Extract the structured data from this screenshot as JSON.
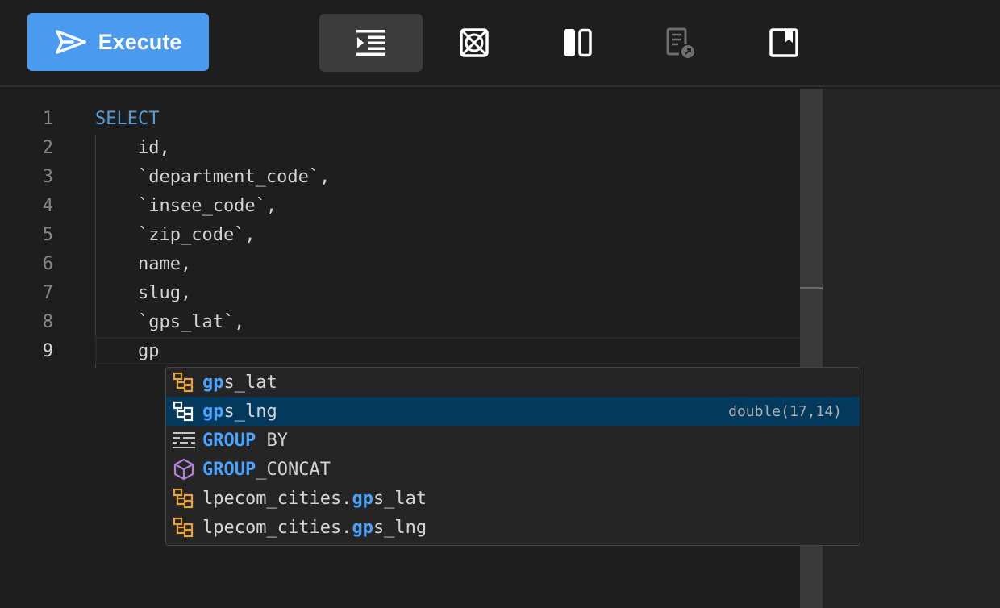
{
  "toolbar": {
    "execute_label": "Execute",
    "tools": [
      {
        "icon": "indent-icon",
        "active": true
      },
      {
        "icon": "clear-icon",
        "active": false
      },
      {
        "icon": "split-view-icon",
        "active": false
      },
      {
        "icon": "document-export-icon",
        "active": false,
        "disabled": true
      },
      {
        "icon": "bookmark-icon",
        "active": false
      }
    ]
  },
  "editor": {
    "lines": [
      {
        "num": "1",
        "text": "SELECT"
      },
      {
        "num": "2",
        "text": "    id,"
      },
      {
        "num": "3",
        "text": "    `department_code`,"
      },
      {
        "num": "4",
        "text": "    `insee_code`,"
      },
      {
        "num": "5",
        "text": "    `zip_code`,"
      },
      {
        "num": "6",
        "text": "    name,"
      },
      {
        "num": "7",
        "text": "    slug,"
      },
      {
        "num": "8",
        "text": "    `gps_lat`,"
      },
      {
        "num": "9",
        "text": "    gp"
      }
    ],
    "current_line": "9"
  },
  "suggest": {
    "items": [
      {
        "icon": "field-icon",
        "match": "gp",
        "rest": "s_lat",
        "prefix": "",
        "detail": ""
      },
      {
        "icon": "field-icon",
        "match": "gp",
        "rest": "s_lng",
        "prefix": "",
        "detail": "double(17,14)",
        "selected": true
      },
      {
        "icon": "keyword-icon",
        "match": "GROU",
        "bold_tail": "P",
        "rest": " BY",
        "prefix": "",
        "detail": ""
      },
      {
        "icon": "function-icon",
        "match": "GROU",
        "bold_tail": "P",
        "rest": "_CONCAT",
        "prefix": "",
        "detail": ""
      },
      {
        "icon": "field-icon",
        "prefix": "lpecom_cities.",
        "match": "gp",
        "rest": "s_lat",
        "detail": ""
      },
      {
        "icon": "field-icon",
        "prefix": "lpecom_cities.",
        "match": "gp",
        "rest": "s_lng",
        "detail": ""
      }
    ]
  },
  "colors": {
    "accent": "#4a9bf0",
    "keyword": "#569cd6",
    "match_highlight": "#4aa3ff",
    "selection": "#04395e",
    "field_icon": "#e8a33d",
    "function_icon": "#b180d7"
  }
}
